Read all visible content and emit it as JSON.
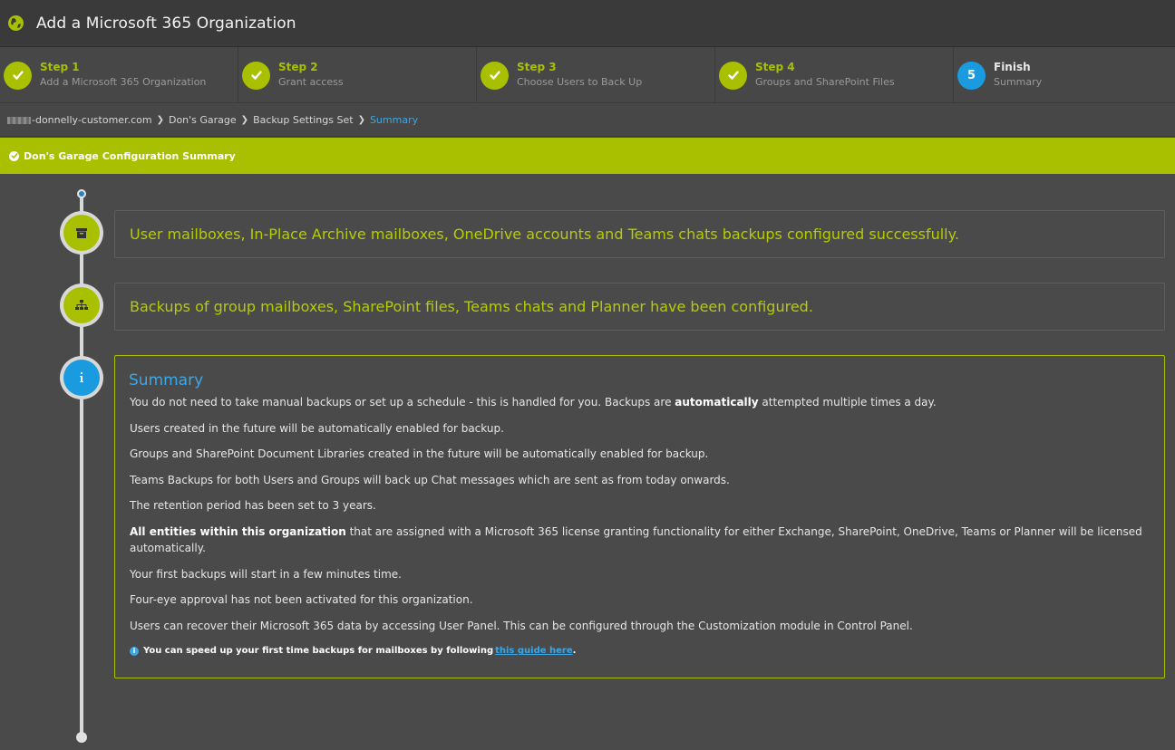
{
  "window": {
    "title": "Add a Microsoft 365 Organization",
    "icon": "globe-icon"
  },
  "steps": [
    {
      "title": "Step 1",
      "subtitle": "Add a Microsoft 365 Organization",
      "status": "complete"
    },
    {
      "title": "Step 2",
      "subtitle": "Grant access",
      "status": "complete"
    },
    {
      "title": "Step 3",
      "subtitle": "Choose Users to Back Up",
      "status": "complete"
    },
    {
      "title": "Step 4",
      "subtitle": "Groups and SharePoint Files",
      "status": "complete"
    },
    {
      "title": "Finish",
      "subtitle": "Summary",
      "status": "active",
      "number": "5"
    }
  ],
  "breadcrumb": {
    "items": [
      "-donnelly-customer.com",
      "Don's Garage",
      "Backup Settings Set"
    ],
    "current": "Summary"
  },
  "summary_header": "Don's Garage Configuration Summary",
  "timeline": [
    {
      "icon": "archive-icon",
      "message": "User mailboxes, In-Place Archive mailboxes, OneDrive accounts and Teams chats backups configured successfully."
    },
    {
      "icon": "sitemap-icon",
      "message": "Backups of group mailboxes, SharePoint files, Teams chats and Planner have been configured."
    }
  ],
  "summary": {
    "icon": "info-icon",
    "title": "Summary",
    "p1_pre": "You do not need to take manual backups or set up a schedule - this is handled for you. Backups are ",
    "p1_bold": "automatically",
    "p1_post": " attempted multiple times a day.",
    "p2": "Users created in the future will be automatically enabled for backup.",
    "p3": "Groups and SharePoint Document Libraries created in the future will be automatically enabled for backup.",
    "p4": "Teams Backups for both Users and Groups will back up Chat messages which are sent as from today onwards.",
    "p5": "The retention period has been set to 3 years.",
    "p6_bold": "All entities within this organization",
    "p6_post": " that are assigned with a Microsoft 365 license granting functionality for either Exchange, SharePoint, OneDrive, Teams or Planner will be licensed automatically.",
    "p7": "Your first backups will start in a few minutes time.",
    "p8": "Four-eye approval has not been activated for this organization.",
    "p9": "Users can recover their Microsoft 365 data by accessing User Panel. This can be configured through the Customization module in Control Panel.",
    "tip_text": "You can speed up your first time backups for mailboxes by following ",
    "tip_link": "this guide here",
    "tip_end": "."
  },
  "colors": {
    "accent_green": "#a8c000",
    "accent_blue": "#1a9be0",
    "background": "#4a4a4a"
  }
}
